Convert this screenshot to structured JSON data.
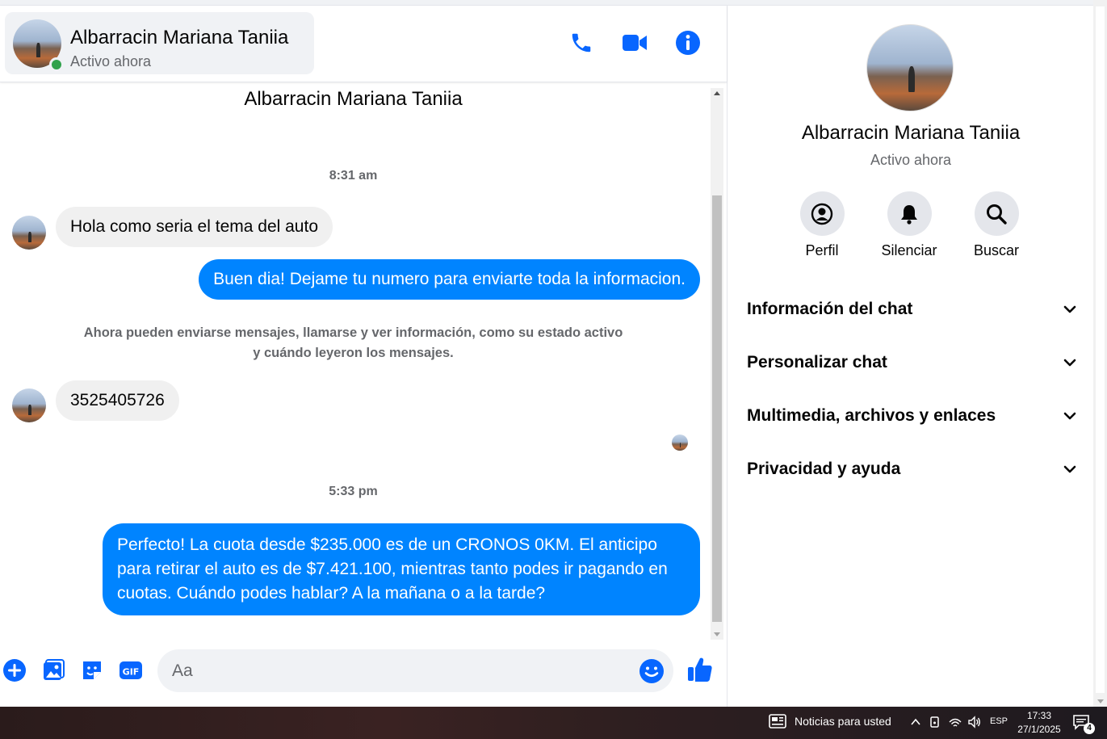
{
  "header": {
    "contact_name": "Albarracin Mariana Taniia",
    "status": "Activo ahora"
  },
  "conversation": {
    "title": "Albarracin Mariana Taniia",
    "timestamp_1": "8:31 am",
    "msg_in_1": "Hola como seria el tema del auto",
    "msg_out_1": "Buen dia! Dejame tu numero para enviarte toda la informacion.",
    "system_note": "Ahora pueden enviarse mensajes, llamarse y ver información, como su estado activo y cuándo leyeron los mensajes.",
    "msg_in_2": "3525405726",
    "timestamp_2": "5:33 pm",
    "msg_out_2": "Perfecto! La cuota desde $235.000 es de un CRONOS 0KM. El anticipo para retirar el auto es de $7.421.100, mientras tanto podes ir pagando en cuotas. Cuándo podes hablar? A la mañana o a la tarde?"
  },
  "composer": {
    "placeholder": "Aa",
    "gif_label": "GIF"
  },
  "info_panel": {
    "name": "Albarracin Mariana Taniia",
    "status": "Activo ahora",
    "actions": [
      {
        "label": "Perfil",
        "icon": "profile-icon"
      },
      {
        "label": "Silenciar",
        "icon": "bell-icon"
      },
      {
        "label": "Buscar",
        "icon": "search-icon"
      }
    ],
    "sections": [
      {
        "label": "Información del chat"
      },
      {
        "label": "Personalizar chat"
      },
      {
        "label": "Multimedia, archivos y enlaces"
      },
      {
        "label": "Privacidad y ayuda"
      }
    ]
  },
  "taskbar": {
    "news_label": "Noticias para usted",
    "language": "ESP",
    "time": "17:33",
    "date": "27/1/2025",
    "notification_count": "4"
  },
  "colors": {
    "accent": "#0084ff",
    "icon_blue": "#0866ff",
    "online": "#31a24c"
  }
}
